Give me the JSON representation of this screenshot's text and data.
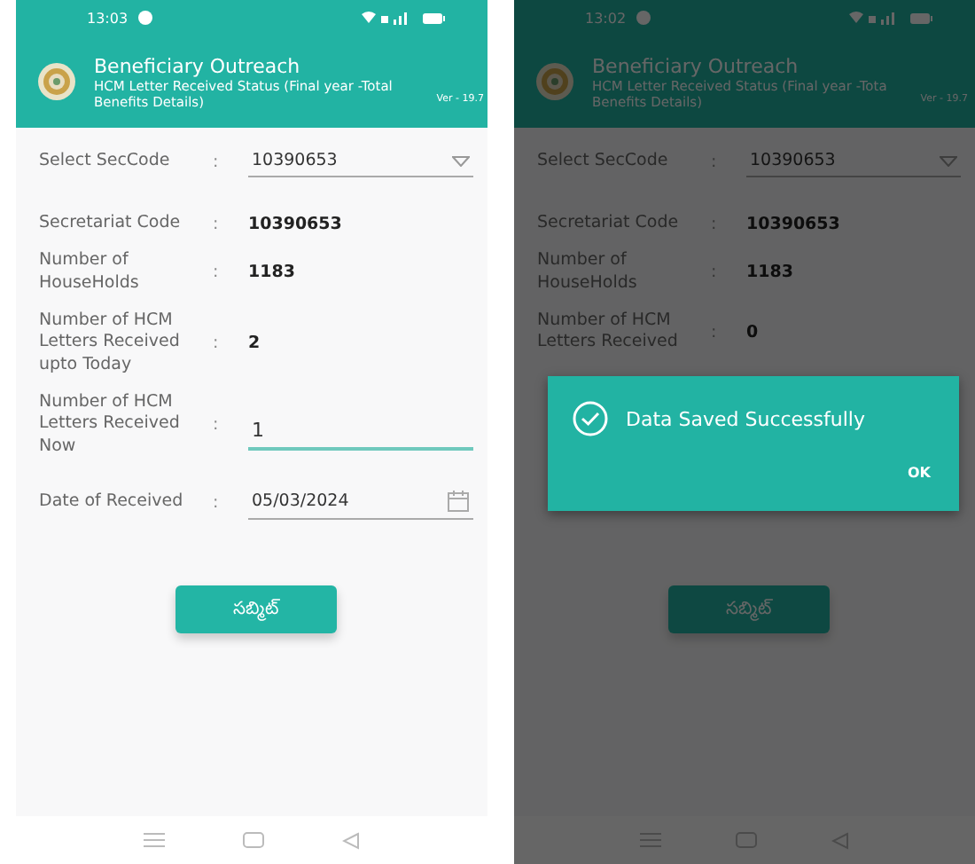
{
  "screens": [
    {
      "status_time": "13:03",
      "dimmed": false,
      "header": {
        "title": "Beneficiary Outreach",
        "subtitle": "HCM Letter Received Status (Final year -Total",
        "subtitle_2": "Benefits Details)",
        "version": "Ver - 19.7"
      },
      "fields": [
        {
          "kind": "select",
          "label": "Select SecCode",
          "separator": ":",
          "value": "10390653"
        },
        {
          "kind": "text",
          "label": "Secretariat Code",
          "separator": ":",
          "value": "10390653"
        },
        {
          "kind": "text",
          "label": "Number of HouseHolds",
          "separator": ":",
          "value": "1183"
        },
        {
          "kind": "text",
          "label": "Number of HCM Letters Received upto Today",
          "separator": ":",
          "value": "2"
        },
        {
          "kind": "input",
          "label": "Number of HCM Letters Received Now",
          "separator": ":",
          "value": "1"
        },
        {
          "kind": "date",
          "label": "Date of Received",
          "separator": ":",
          "value": "05/03/2024"
        }
      ],
      "submit": "సబ్మిట్"
    },
    {
      "status_time": "13:02",
      "dimmed": true,
      "header": {
        "title": "Beneficiary Outreach",
        "subtitle": "HCM Letter Received Status (Final year -Tota",
        "subtitle_2": "Benefits Details)",
        "version": "Ver - 19.7"
      },
      "fields": [
        {
          "kind": "select",
          "label": "Select SecCode",
          "separator": ":",
          "value": "10390653"
        },
        {
          "kind": "text",
          "label": "Secretariat Code",
          "separator": ":",
          "value": "10390653"
        },
        {
          "kind": "text",
          "label": "Number of HouseHolds",
          "separator": ":",
          "value": "1183"
        },
        {
          "kind": "text",
          "label": "Number of HCM Letters Received",
          "separator": ":",
          "value": "0"
        }
      ],
      "dialog": {
        "message": "Data Saved Successfully",
        "button": "OK"
      },
      "submit": "సబ్మిట్"
    }
  ]
}
